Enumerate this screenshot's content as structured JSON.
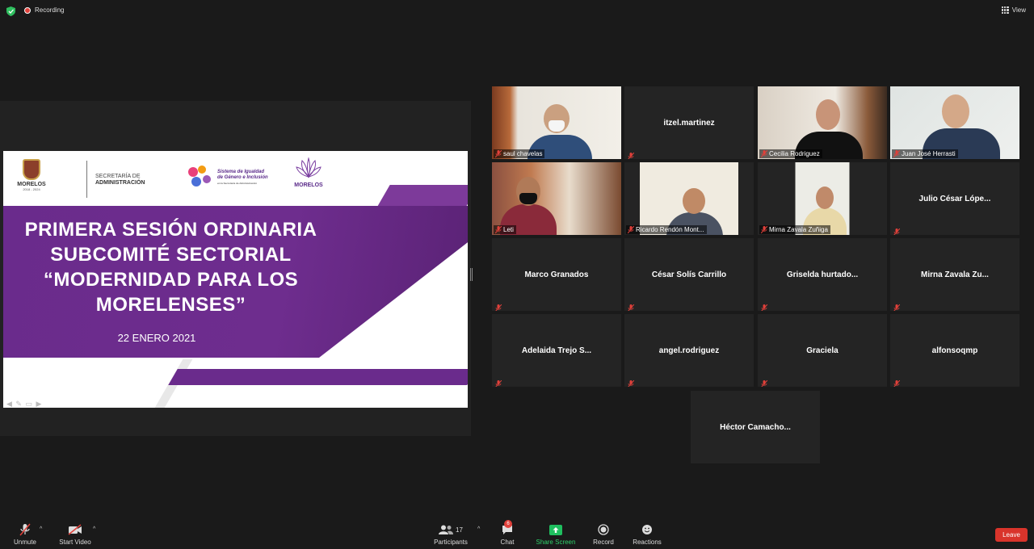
{
  "topbar": {
    "recording_label": "Recording",
    "view_label": "View"
  },
  "slide": {
    "logo_morelos": "MORELOS",
    "logo_morelos_years": "2018 - 2024",
    "secretaria_line1": "SECRETARÍA DE",
    "secretaria_line2": "ADMINISTRACIÓN",
    "sistema_line1": "Sistema de Igualdad",
    "sistema_line2": "de Género e Inclusión",
    "sistema_line3": "en la Secretaría de Administración",
    "logo_morelos2": "MORELOS",
    "title_line1": "PRIMERA SESIÓN ORDINARIA",
    "title_line2": "SUBCOMITÉ SECTORIAL",
    "title_line3": "“MODERNIDAD PARA LOS",
    "title_line4": "MORELENSES”",
    "date": "22 ENERO 2021"
  },
  "participants": [
    {
      "name": "saul chavelas",
      "video": true
    },
    {
      "name": "itzel.martinez",
      "video": false
    },
    {
      "name": "Cecilia Rodriguez",
      "video": true
    },
    {
      "name": "Juan José Herrasti",
      "video": true,
      "active_speaker": true
    },
    {
      "name": "Leti",
      "video": true
    },
    {
      "name": "Ricardo Rendón Mont...",
      "video": true
    },
    {
      "name": "Mirna Zavala Zuñiga",
      "video": true
    },
    {
      "name": "Julio César Lópe...",
      "video": false
    },
    {
      "name": "Marco Granados",
      "video": false
    },
    {
      "name": "César Solís Carrillo",
      "video": false
    },
    {
      "name": "Griselda  hurtado...",
      "video": false
    },
    {
      "name": "Mirna Zavala Zu...",
      "video": false
    },
    {
      "name": "Adelaida Trejo S...",
      "video": false
    },
    {
      "name": "angel.rodriguez",
      "video": false
    },
    {
      "name": "Graciela",
      "video": false
    },
    {
      "name": "alfonsoqmp",
      "video": false
    },
    {
      "name": "Héctor  Camacho...",
      "video": false
    }
  ],
  "toolbar": {
    "unmute": "Unmute",
    "start_video": "Start Video",
    "participants": "Participants",
    "participants_count": "17",
    "chat": "Chat",
    "chat_badge": "6",
    "share_screen": "Share Screen",
    "record": "Record",
    "reactions": "Reactions",
    "leave": "Leave"
  },
  "colors": {
    "accent_green": "#1fbf5f",
    "leave_red": "#d9342b",
    "active_outline": "#c8e05a",
    "slide_purple": "#6a2b8c"
  }
}
